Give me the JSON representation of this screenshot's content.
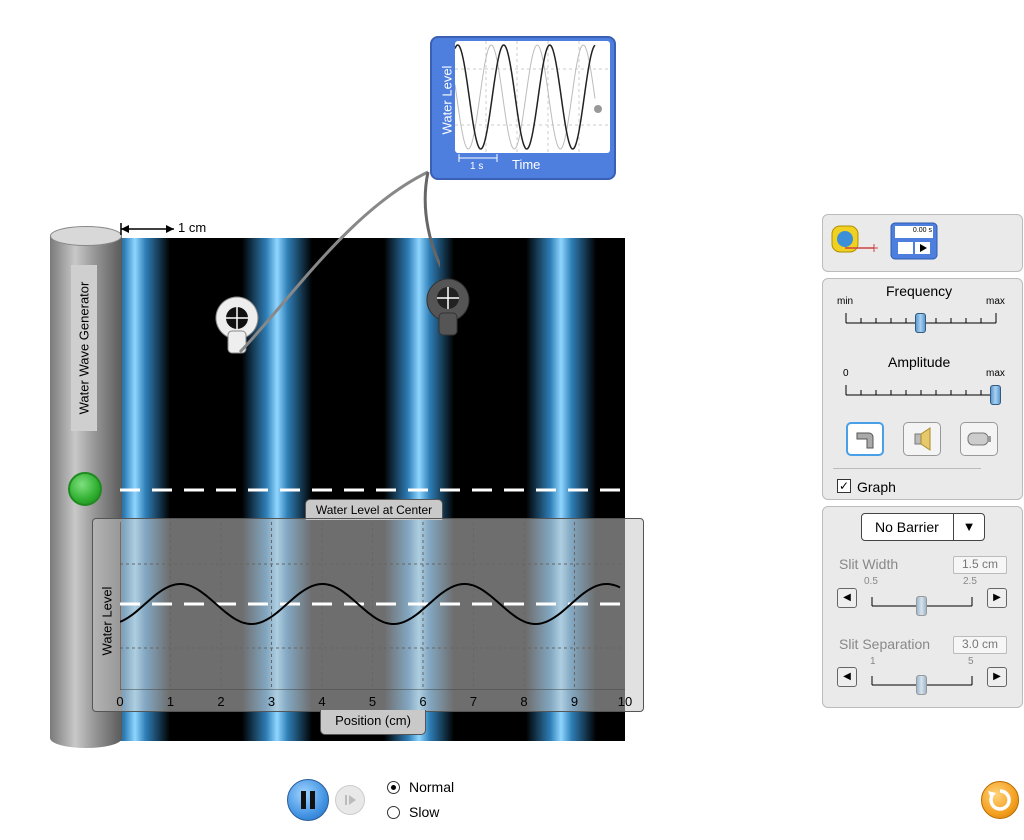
{
  "scale": {
    "label": "1 cm"
  },
  "generator": {
    "label": "Water Wave Generator"
  },
  "chart_device": {
    "y_label": "Water Level",
    "x_label": "Time",
    "scale_label": "1 s"
  },
  "graph": {
    "tab_label": "Water Level at Center",
    "y_label": "Water Level",
    "x_label": "Position (cm)",
    "ticks": [
      "0",
      "1",
      "2",
      "3",
      "4",
      "5",
      "6",
      "7",
      "8",
      "9",
      "10"
    ]
  },
  "controls": {
    "stopwatch_readout": "0.00 s",
    "frequency": {
      "label": "Frequency",
      "min_label": "min",
      "max_label": "max",
      "value": 0.5
    },
    "amplitude": {
      "label": "Amplitude",
      "min_label": "0",
      "max_label": "max",
      "value": 1.0
    },
    "sources": [
      "faucet-icon",
      "speaker-icon",
      "laser-icon"
    ],
    "selected_source": "faucet-icon",
    "graph_checkbox": {
      "label": "Graph",
      "checked": true
    }
  },
  "barrier": {
    "selected": "No Barrier",
    "slit_width": {
      "label": "Slit Width",
      "value_text": "1.5 cm",
      "min_label": "0.5",
      "max_label": "2.5",
      "value": 1.5
    },
    "slit_separation": {
      "label": "Slit Separation",
      "value_text": "3.0 cm",
      "min_label": "1",
      "max_label": "5",
      "value": 3.0
    }
  },
  "playback": {
    "speed_options": [
      "Normal",
      "Slow"
    ],
    "selected_speed": "Normal"
  },
  "colors": {
    "wave_blue": "#5ab4ee",
    "panel_bg": "#eaeaea",
    "accent": "#4f7fde"
  }
}
